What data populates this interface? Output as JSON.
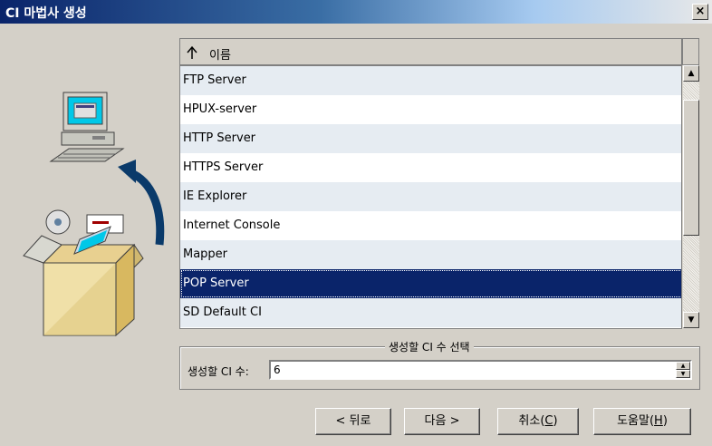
{
  "window": {
    "title": "CI 마법사 생성",
    "close_glyph": "×"
  },
  "list": {
    "header_label": "이름",
    "items": [
      "FTP Server",
      "HPUX-server",
      "HTTP Server",
      "HTTPS Server",
      "IE Explorer",
      "Internet Console",
      "Mapper",
      "POP Server",
      "SD Default CI"
    ],
    "selected": "POP Server"
  },
  "group": {
    "title": "생성할 CI 수 선택",
    "field_label": "생성할 CI 수:",
    "value": "6"
  },
  "buttons": {
    "back": "< 뒤로",
    "next": "다음 >",
    "cancel_text": "취소(",
    "cancel_key": "C",
    "cancel_end": ")",
    "help_text": "도움말(",
    "help_key": "H",
    "help_end": ")"
  },
  "icons": [
    "computer-icon",
    "install-box-icon",
    "curved-arrow-icon",
    "sort-ascending-icon",
    "scroll-up-icon",
    "scroll-down-icon",
    "spin-up-icon",
    "spin-down-icon",
    "close-icon"
  ]
}
